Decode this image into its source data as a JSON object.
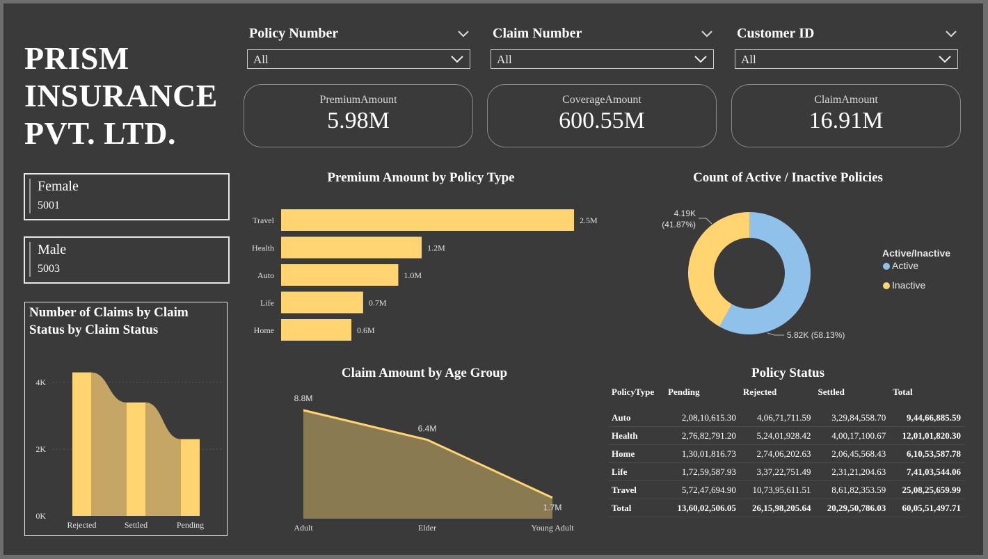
{
  "company": {
    "line1": "PRISM",
    "line2": "INSURANCE",
    "line3": "PVT. LTD."
  },
  "slicers": [
    {
      "label": "Policy Number",
      "value": "All"
    },
    {
      "label": "Claim Number",
      "value": "All"
    },
    {
      "label": "Customer ID",
      "value": "All"
    }
  ],
  "kpis": [
    {
      "label": "PremiumAmount",
      "value": "5.98M"
    },
    {
      "label": "CoverageAmount",
      "value": "600.55M"
    },
    {
      "label": "ClaimAmount",
      "value": "16.91M"
    }
  ],
  "gender": [
    {
      "label": "Female",
      "value": "5001"
    },
    {
      "label": "Male",
      "value": "5003"
    }
  ],
  "icons": {
    "chevron": "chevron-down-icon"
  },
  "colors": {
    "accent": "#ffd471",
    "active": "#8fc1ea",
    "inactive": "#ffd471",
    "background": "#3a3a3a"
  },
  "chart_data": [
    {
      "type": "bar",
      "title": "Premium Amount by Policy Type",
      "categories": [
        "Travel",
        "Health",
        "Auto",
        "Life",
        "Home"
      ],
      "values": [
        2.5,
        1.2,
        1.0,
        0.7,
        0.6
      ],
      "value_labels": [
        "2.5M",
        "1.2M",
        "1.0M",
        "0.7M",
        "0.6M"
      ],
      "orientation": "horizontal"
    },
    {
      "type": "pie",
      "title": "Count of Active / Inactive Policies",
      "legend_title": "Active/Inactive",
      "legend_position": "right",
      "categories": [
        "Active",
        "Inactive"
      ],
      "values": [
        5.82,
        4.19
      ],
      "labels": [
        "5.82K (58.13%)",
        "4.19K (41.87%)"
      ],
      "percents": [
        58.13,
        41.87
      ]
    },
    {
      "type": "bar",
      "title": "Number of Claims by Claim Status by Claim Status",
      "categories": [
        "Rejected",
        "Settled",
        "Pending"
      ],
      "values": [
        4.3,
        3.4,
        2.3
      ],
      "y_ticks": [
        "0K",
        "2K",
        "4K"
      ],
      "ylim": [
        0,
        5
      ]
    },
    {
      "type": "area",
      "title": "Claim Amount by Age Group",
      "categories": [
        "Adult",
        "Elder",
        "Young Adult"
      ],
      "values": [
        8.8,
        6.4,
        1.7
      ],
      "value_labels": [
        "8.8M",
        "6.4M",
        "1.7M"
      ]
    }
  ],
  "policy_table": {
    "title": "Policy Status",
    "columns": [
      "PolicyType",
      "Pending",
      "Rejected",
      "Settled",
      "Total"
    ],
    "rows": [
      [
        "Auto",
        "2,08,10,615.30",
        "4,06,71,711.59",
        "3,29,84,558.70",
        "9,44,66,885.59"
      ],
      [
        "Health",
        "2,76,82,791.20",
        "5,24,01,928.42",
        "4,00,17,100.67",
        "12,01,01,820.30"
      ],
      [
        "Home",
        "1,30,01,816.73",
        "2,74,06,202.63",
        "2,06,45,568.43",
        "6,10,53,587.78"
      ],
      [
        "Life",
        "1,72,59,587.93",
        "3,37,22,751.49",
        "2,31,21,204.63",
        "7,41,03,544.06"
      ],
      [
        "Travel",
        "5,72,47,694.90",
        "10,73,95,611.51",
        "8,61,82,353.59",
        "25,08,25,659.99"
      ]
    ],
    "total_row": [
      "Total",
      "13,60,02,506.05",
      "26,15,98,205.64",
      "20,29,50,786.03",
      "60,05,51,497.71"
    ]
  }
}
